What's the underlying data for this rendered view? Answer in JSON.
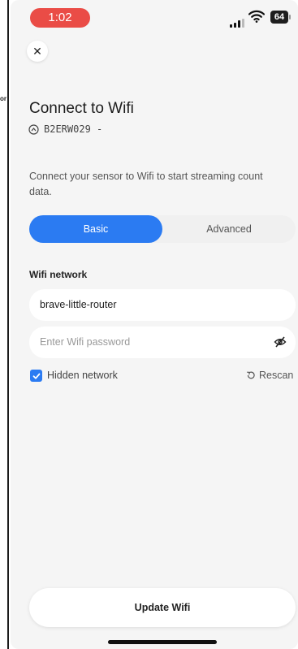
{
  "status_bar": {
    "time": "1:02",
    "battery": "64",
    "accent": "#ea4c46"
  },
  "edge_text": "or",
  "header": {
    "close_icon": "close-icon",
    "title": "Connect to Wifi",
    "device_id": "B2ERW029 -"
  },
  "description": "Connect your sensor to Wifi to start streaming count data.",
  "tabs": {
    "basic": "Basic",
    "advanced": "Advanced",
    "selected": "Basic",
    "accent": "#2b7bf2"
  },
  "form": {
    "network_label": "Wifi network",
    "network_value": "brave-little-router",
    "password_placeholder": "Enter Wifi password",
    "hidden_network_label": "Hidden network",
    "hidden_network_checked": true,
    "rescan_label": "Rescan"
  },
  "actions": {
    "update_label": "Update Wifi"
  }
}
